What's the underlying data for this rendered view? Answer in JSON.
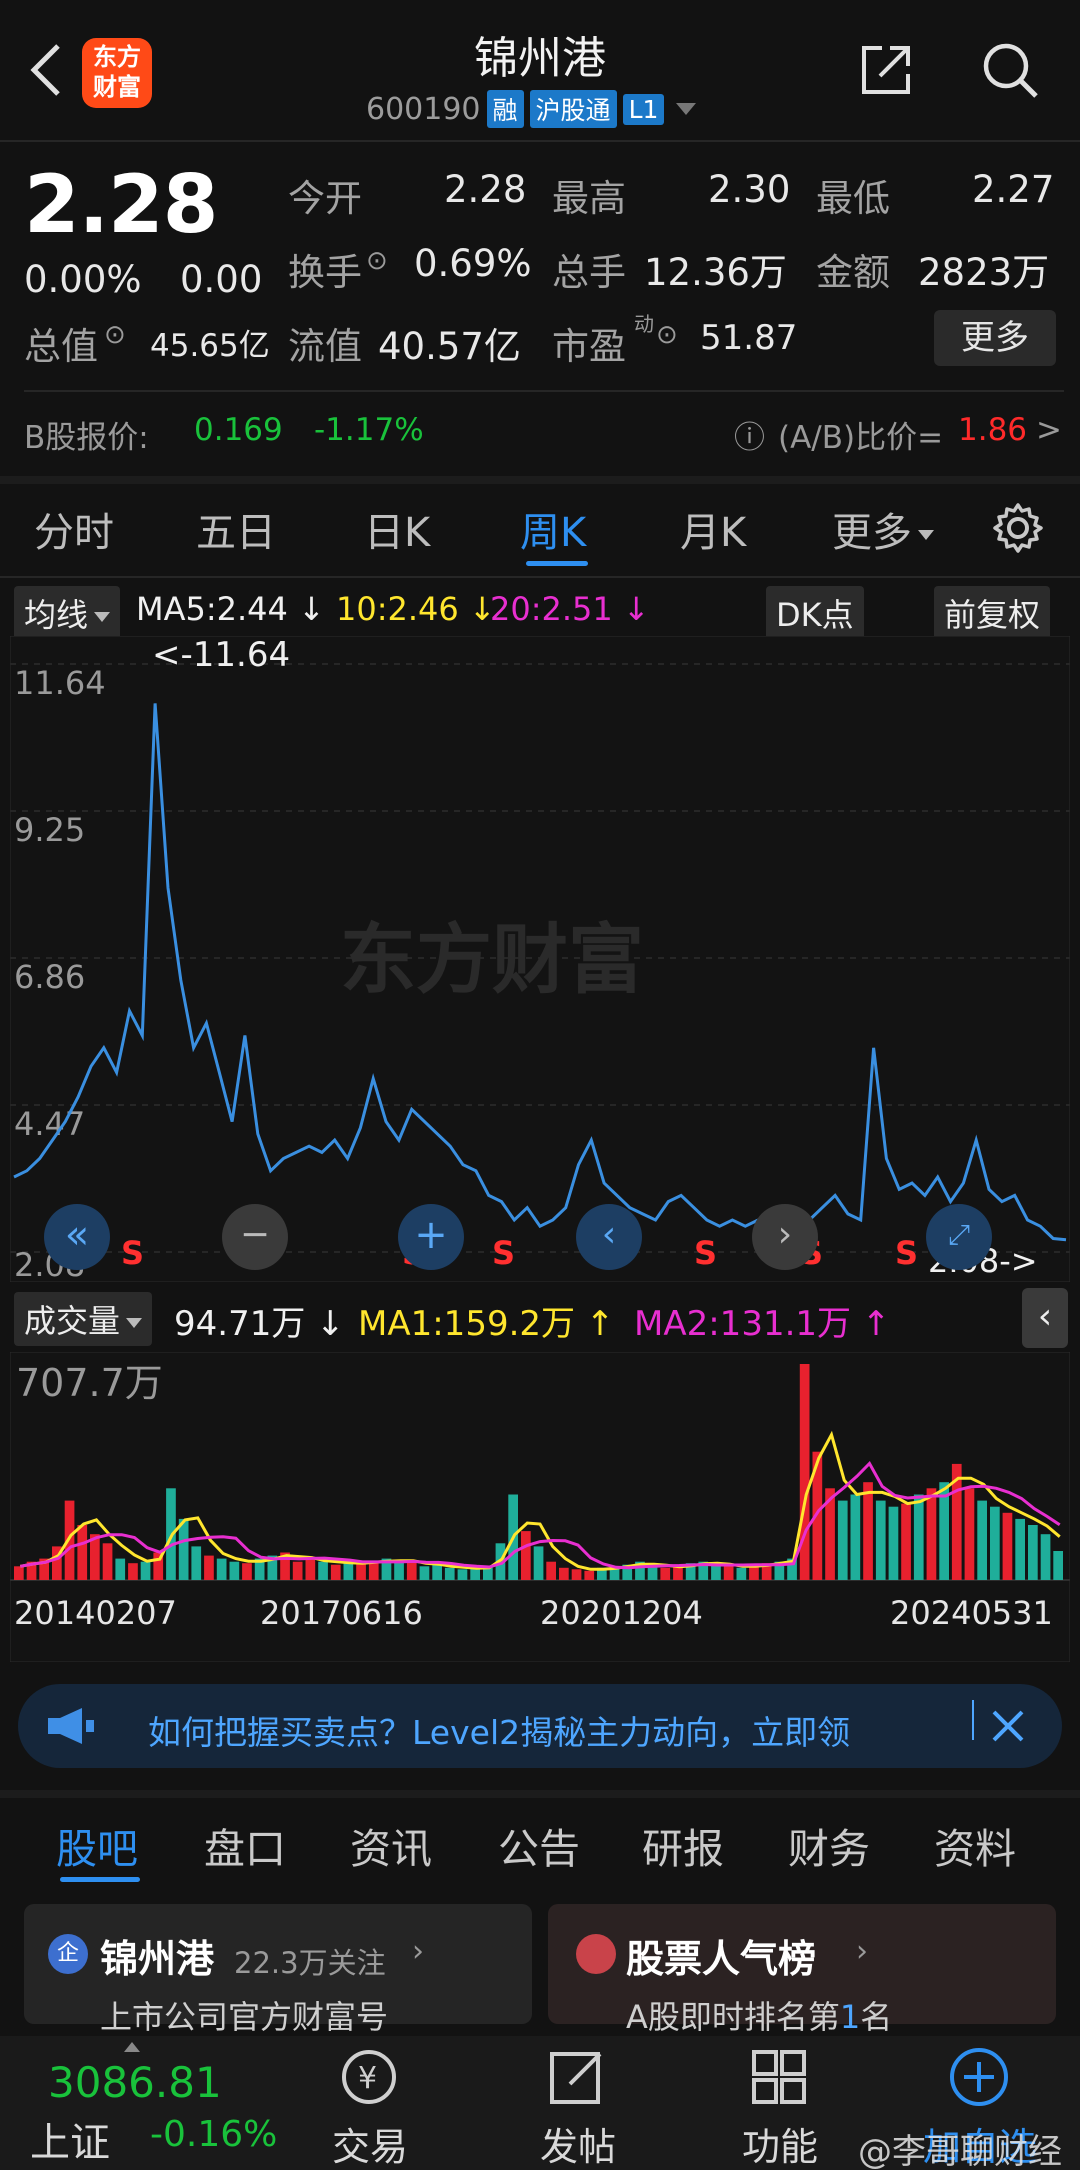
{
  "header": {
    "logo_text": "东方财富",
    "stock_name": "锦州港",
    "stock_code": "600190",
    "tags": [
      "融",
      "沪股通",
      "L1"
    ]
  },
  "quote": {
    "price": "2.28",
    "change_pct": "0.00%",
    "change": "0.00",
    "open_label": "今开",
    "open": "2.28",
    "high_label": "最高",
    "high": "2.30",
    "low_label": "最低",
    "low": "2.27",
    "turnover_label": "换手",
    "turnover": "0.69%",
    "volume_label": "总手",
    "volume": "12.36万",
    "amount_label": "金额",
    "amount": "2823万",
    "mktcap_label": "总值",
    "mktcap": "45.65亿",
    "float_label": "流值",
    "float_cap": "40.57亿",
    "pe_label": "市盈",
    "pe_sup": "动",
    "pe": "51.87",
    "more_label": "更多"
  },
  "b_share": {
    "label": "B股报价:",
    "price": "0.169",
    "change": "-1.17%",
    "ratio_label": "(A/B)比价=",
    "ratio": "1.86",
    "arrow": ">"
  },
  "period_tabs": [
    "分时",
    "五日",
    "日K",
    "周K",
    "月K",
    "更多"
  ],
  "active_period": "周K",
  "ma_bar": {
    "selector": "均线",
    "ma5": "MA5:2.44",
    "ma10": "10:2.46",
    "ma20": "20:2.51",
    "dk_label": "DK点",
    "adjust_label": "前复权"
  },
  "price_axis": [
    "11.64",
    "9.25",
    "6.86",
    "4.47",
    "2.08"
  ],
  "max_marker": "<-11.64",
  "min_marker": "2.08->",
  "signal_label": "S",
  "volume_bar": {
    "selector": "成交量",
    "value": "94.71万",
    "ma1": "MA1:159.2万",
    "ma2": "MA2:131.1万",
    "max_label": "707.7万"
  },
  "date_axis": [
    "20140207",
    "20170616",
    "20201204",
    "20240531"
  ],
  "colors": {
    "accent": "#2e8ff0",
    "up": "#ff2a2a",
    "down": "#19c23b",
    "ma_yellow": "#ffe62e",
    "ma_magenta": "#e82fd0",
    "price_line": "#3a8fe0"
  },
  "chart_data": {
    "type": "line",
    "x_ticks": [
      "20140207",
      "20170616",
      "20201204",
      "20240531"
    ],
    "ylim": [
      2.08,
      11.64
    ],
    "series": [
      {
        "values": [
          3.3,
          3.4,
          3.6,
          3.9,
          4.2,
          4.6,
          5.1,
          5.4,
          5.0,
          6.0,
          5.6,
          11.0,
          8.0,
          6.5,
          5.4,
          5.8,
          5.0,
          4.2,
          5.6,
          4.0,
          3.4,
          3.6,
          3.7,
          3.8,
          3.7,
          3.9,
          3.6,
          4.1,
          4.9,
          4.2,
          3.9,
          4.4,
          4.2,
          4.0,
          3.8,
          3.5,
          3.4,
          3.0,
          2.9,
          2.6,
          2.8,
          2.5,
          2.6,
          2.8,
          3.5,
          3.9,
          3.2,
          3.0,
          2.8,
          2.7,
          2.6,
          2.9,
          3.0,
          2.8,
          2.6,
          2.5,
          2.6,
          2.5,
          2.6,
          2.7,
          2.5,
          2.4,
          2.6,
          2.8,
          3.0,
          2.7,
          2.6,
          5.4,
          3.6,
          3.1,
          3.2,
          3.0,
          3.3,
          2.9,
          3.2,
          3.9,
          3.1,
          2.9,
          3.0,
          2.6,
          2.5,
          2.3,
          2.28
        ]
      },
      {
        "name": "成交量",
        "values": [
          45,
          60,
          70,
          110,
          260,
          180,
          150,
          120,
          70,
          55,
          60,
          90,
          300,
          200,
          110,
          80,
          70,
          60,
          55,
          70,
          80,
          90,
          60,
          70,
          60,
          50,
          60,
          55,
          60,
          70,
          60,
          60,
          45,
          50,
          40,
          35,
          40,
          45,
          120,
          280,
          160,
          110,
          60,
          40,
          35,
          30,
          40,
          45,
          50,
          60,
          45,
          40,
          45,
          55,
          60,
          50,
          45,
          40,
          50,
          55,
          60,
          70,
          707,
          420,
          300,
          260,
          280,
          320,
          260,
          240,
          250,
          280,
          300,
          320,
          380,
          300,
          260,
          240,
          220,
          200,
          180,
          150,
          95
        ]
      }
    ]
  },
  "banner": {
    "text": "如何把握买卖点？Level2揭秘主力动向，立即领"
  },
  "content_tabs": [
    "股吧",
    "盘口",
    "资讯",
    "公告",
    "研报",
    "财务",
    "资料"
  ],
  "active_content_tab": "股吧",
  "cards": {
    "left_title": "锦州港",
    "left_follow": "22.3万关注",
    "left_sub": "上市公司官方财富号",
    "left_badge": "企",
    "right_title": "股票人气榜",
    "right_sub_pre": "A股即时排名第",
    "right_rank": "1",
    "right_sub_post": "名"
  },
  "bottom_nav": {
    "index_value": "3086.81",
    "index_name": "上证",
    "index_change": "-0.16%",
    "items": [
      "交易",
      "发帖",
      "功能",
      "加自选"
    ]
  },
  "watermark": "@李哥聊财经"
}
